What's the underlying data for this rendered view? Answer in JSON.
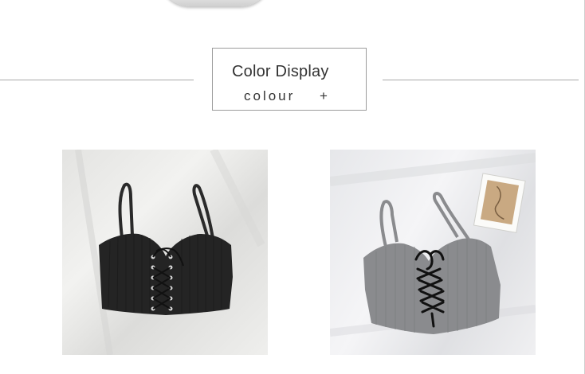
{
  "header": {
    "title": "Color Display",
    "subtitle": "colour",
    "plus": "+"
  },
  "products": [
    {
      "name": "black lace-up knit cami top",
      "color": "#232323"
    },
    {
      "name": "gray lace-up knit cami top",
      "color": "#8a8b8e"
    }
  ],
  "colors": {
    "divider": "#a9a9a9",
    "text": "#333333"
  }
}
